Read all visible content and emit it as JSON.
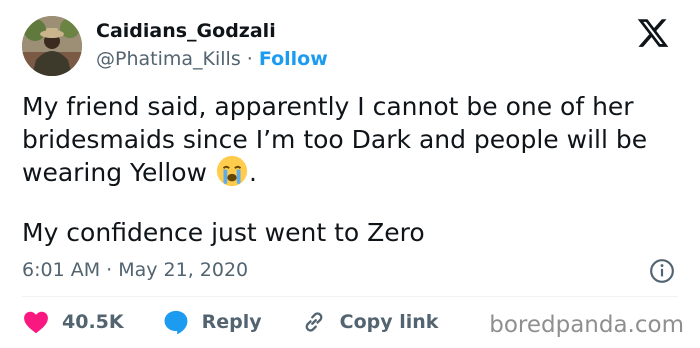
{
  "author": {
    "display_name": "Caidians_Godzali",
    "handle": "@Phatima_Kills",
    "separator": "·",
    "follow_label": "Follow",
    "avatar_icon": "profile-photo"
  },
  "brand_icon": "x-logo-icon",
  "tweet": {
    "paragraph1_before_emoji": "My friend said, apparently I cannot be one of her bridesmaids since I’m too Dark and people will be wearing Yellow ",
    "emoji": "loudly-crying-face",
    "paragraph1_after_emoji": ".",
    "paragraph2": "My confidence just went to Zero"
  },
  "meta": {
    "timestamp": "6:01 AM · May 21, 2020",
    "info_icon": "info-icon"
  },
  "actions": {
    "like_count": "40.5K",
    "reply_label": "Reply",
    "copy_link_label": "Copy link"
  },
  "watermark": "boredpanda.com",
  "colors": {
    "follow": "#1d9bf0",
    "heart": "#f91880",
    "reply": "#1d9bf0",
    "secondary_text": "#536471"
  }
}
